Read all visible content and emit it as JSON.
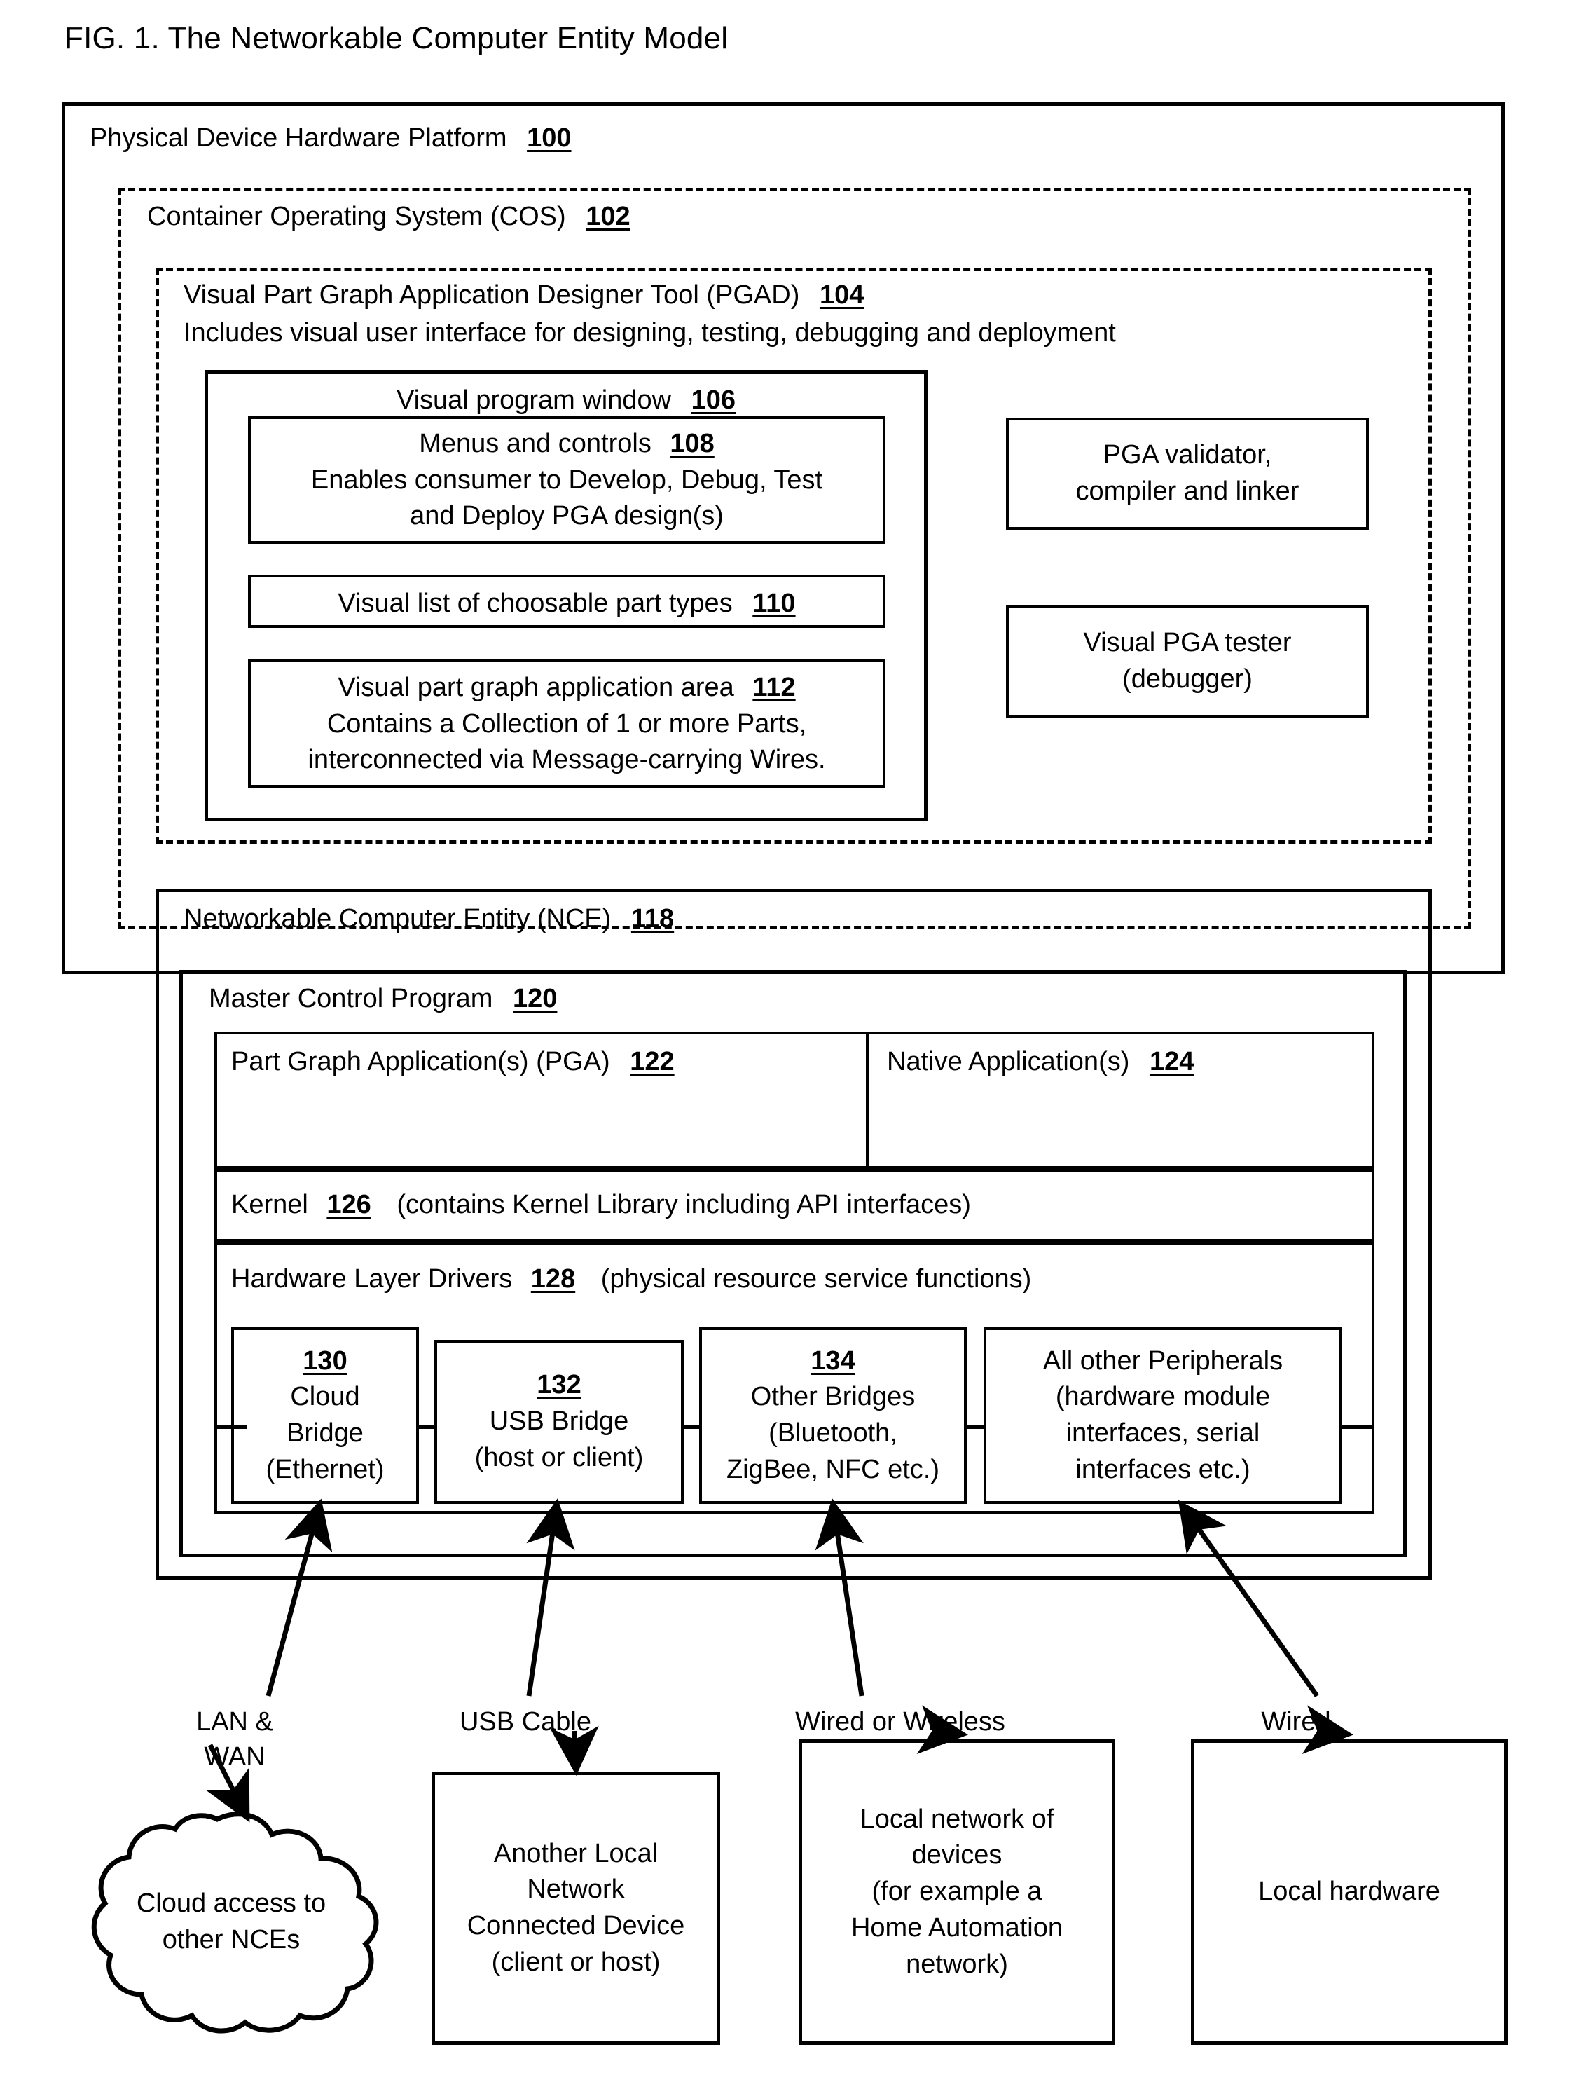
{
  "figure": {
    "caption": "FIG. 1.  The Networkable Computer Entity Model"
  },
  "platform": {
    "title": "Physical Device Hardware Platform",
    "ref": "100"
  },
  "cos": {
    "title": "Container Operating System  (COS)",
    "ref": "102"
  },
  "pgad": {
    "title": "Visual Part Graph Application Designer Tool (PGAD)",
    "ref": "104",
    "subtitle": "Includes visual user interface for designing, testing, debugging and deployment",
    "visual_program_window": {
      "title": "Visual program window",
      "ref": "106",
      "menus": {
        "title": "Menus and controls",
        "ref": "108",
        "line2": "Enables consumer to Develop, Debug, Test",
        "line3": "and Deploy PGA design(s)"
      },
      "part_types": {
        "title": "Visual list of choosable part types",
        "ref": "110"
      },
      "app_area": {
        "title": "Visual part graph application area",
        "ref": "112",
        "line2": "Contains a Collection of 1 or more Parts,",
        "line3": "interconnected via Message-carrying Wires."
      }
    },
    "validator": {
      "line1": "PGA validator,",
      "line2": "compiler and linker"
    },
    "tester": {
      "line1": "Visual PGA tester",
      "line2": "(debugger)"
    }
  },
  "nce": {
    "title": "Networkable Computer Entity (NCE)",
    "ref": "118",
    "mcp": {
      "title": "Master Control Program",
      "ref": "120",
      "pga": {
        "title": "Part Graph Application(s) (PGA)",
        "ref": "122"
      },
      "native": {
        "title": "Native Application(s)",
        "ref": "124"
      },
      "kernel": {
        "title": "Kernel",
        "ref": "126",
        "note": "(contains Kernel Library including API interfaces)"
      },
      "drivers": {
        "title": "Hardware Layer Drivers",
        "ref": "128",
        "note": "(physical resource service functions)"
      },
      "bridges": [
        {
          "ref": "130",
          "lines": [
            "Cloud",
            "Bridge",
            "(Ethernet)"
          ]
        },
        {
          "ref": "132",
          "lines": [
            "USB Bridge",
            "(host or client)"
          ]
        },
        {
          "ref": "134",
          "lines": [
            "Other Bridges",
            "(Bluetooth,",
            "ZigBee, NFC etc.)"
          ]
        },
        {
          "ref": "",
          "lines": [
            "All other Peripherals",
            "(hardware module",
            "interfaces, serial",
            "interfaces etc.)"
          ]
        }
      ]
    }
  },
  "connections": [
    {
      "label_line1": "LAN &",
      "label_line2": "WAN"
    },
    {
      "label_line1": "USB Cable",
      "label_line2": ""
    },
    {
      "label_line1": "Wired or Wireless",
      "label_line2": ""
    },
    {
      "label_line1": "Wired",
      "label_line2": ""
    }
  ],
  "externals": {
    "cloud": {
      "line1": "Cloud access to",
      "line2": "other NCEs"
    },
    "local_device": {
      "lines": [
        "Another Local",
        "Network",
        "Connected Device",
        "(client or host)"
      ]
    },
    "local_network": {
      "lines": [
        "Local network of",
        "devices",
        "(for example a",
        "Home Automation",
        "network)"
      ]
    },
    "local_hardware": {
      "lines": [
        "Local hardware"
      ]
    }
  },
  "colors": {
    "stroke": "#000000",
    "background": "#ffffff"
  }
}
